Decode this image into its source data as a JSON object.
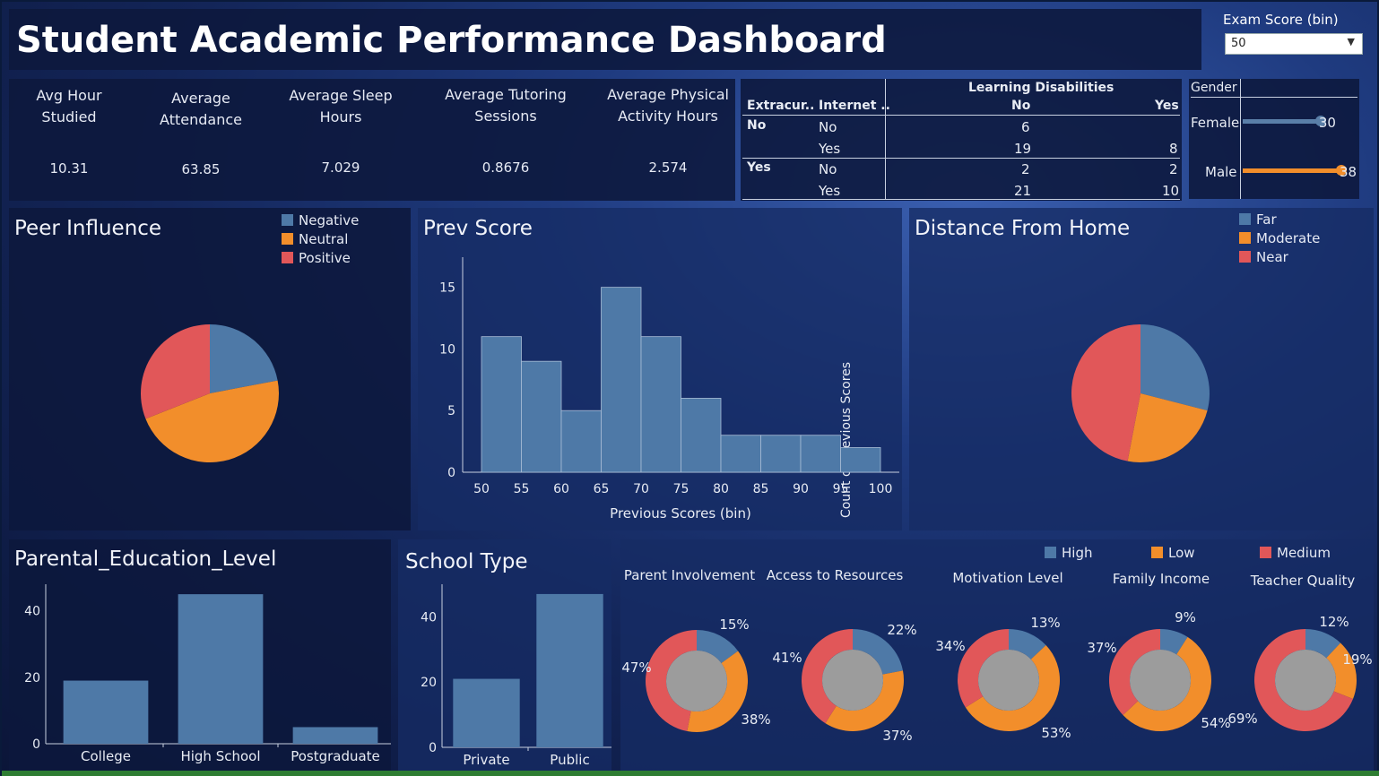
{
  "header": {
    "title": "Student Academic Performance Dashboard"
  },
  "filter": {
    "label": "Exam Score (bin)",
    "value": "50"
  },
  "kpis": [
    {
      "label": "Avg Hour Studied",
      "value": "10.31"
    },
    {
      "label": "Average Attendance",
      "value": "63.85"
    },
    {
      "label": "Average Sleep Hours",
      "value": "7.029"
    },
    {
      "label": "Average Tutoring Sessions",
      "value": "0.8676"
    },
    {
      "label": "Average Physical Activity Hours",
      "value": "2.574"
    }
  ],
  "crosstab": {
    "group_header": "Learning Disabilities",
    "col1": "Extracur..",
    "col2": "Internet ..",
    "sub_no": "No",
    "sub_yes": "Yes",
    "rows": [
      {
        "extra": "No",
        "internet": "No",
        "no": "6",
        "yes": ""
      },
      {
        "extra": "",
        "internet": "Yes",
        "no": "19",
        "yes": "8"
      },
      {
        "extra": "Yes",
        "internet": "No",
        "no": "2",
        "yes": "2"
      },
      {
        "extra": "",
        "internet": "Yes",
        "no": "21",
        "yes": "10"
      }
    ]
  },
  "gender": {
    "title": "Gender",
    "rows": [
      {
        "label": "Female",
        "value": 30,
        "value_text": "30"
      },
      {
        "label": "Male",
        "value": 38,
        "value_text": "38"
      }
    ],
    "max": 38
  },
  "colors": {
    "blue": "#4e79a7",
    "orange": "#f28e2b",
    "red": "#e15759",
    "gray": "#9c9c9c",
    "female_bar": "#5a7fa8",
    "male_bar": "#f28e2b"
  },
  "peer": {
    "title": "Peer Influence",
    "legend": [
      "Negative",
      "Neutral",
      "Positive"
    ]
  },
  "distance": {
    "title": "Distance From Home",
    "legend": [
      "Far",
      "Moderate",
      "Near"
    ]
  },
  "prev": {
    "title": "Prev Score"
  },
  "parental": {
    "title": "Parental_Education_Level"
  },
  "school": {
    "title": "School Type"
  },
  "donuts_legend": [
    "High",
    "Low",
    "Medium"
  ],
  "chart_data": [
    {
      "id": "peer",
      "type": "pie",
      "title": "Peer Influence",
      "legend_position": "top-right",
      "categories": [
        "Negative",
        "Neutral",
        "Positive"
      ],
      "values": [
        22,
        47,
        31
      ]
    },
    {
      "id": "prev",
      "type": "bar",
      "title": "Prev Score",
      "xlabel": "Previous Scores (bin)",
      "ylabel": "Count of Previous Scores",
      "x": [
        50,
        55,
        60,
        65,
        70,
        75,
        80,
        85,
        90,
        95
      ],
      "xticks": [
        "50",
        "55",
        "60",
        "65",
        "70",
        "75",
        "80",
        "85",
        "90",
        "95",
        "100"
      ],
      "values": [
        11,
        9,
        5,
        15,
        11,
        6,
        3,
        3,
        3,
        2
      ],
      "yticks": [
        0,
        5,
        10,
        15
      ],
      "ylim": [
        0,
        16.5
      ],
      "grid": false
    },
    {
      "id": "distance",
      "type": "pie",
      "title": "Distance From Home",
      "legend_position": "top-right",
      "categories": [
        "Far",
        "Moderate",
        "Near"
      ],
      "values": [
        29,
        24,
        47
      ]
    },
    {
      "id": "parental",
      "type": "bar",
      "title": "Parental_Education_Level",
      "categories": [
        "College",
        "High School",
        "Postgraduate"
      ],
      "values": [
        19,
        45,
        5
      ],
      "yticks": [
        0,
        20,
        40
      ],
      "ylim": [
        0,
        48
      ]
    },
    {
      "id": "school",
      "type": "bar",
      "title": "School Type",
      "categories": [
        "Private",
        "Public"
      ],
      "values": [
        21,
        47
      ],
      "yticks": [
        0,
        20,
        40
      ],
      "ylim": [
        0,
        50
      ]
    },
    {
      "id": "donuts",
      "type": "pie",
      "legend": [
        "High",
        "Low",
        "Medium"
      ],
      "charts": [
        {
          "title": "Parent Involvement",
          "values": [
            15,
            38,
            47
          ],
          "labels": [
            "15%",
            "38%",
            "47%"
          ]
        },
        {
          "title": "Access to Resources",
          "values": [
            22,
            37,
            41
          ],
          "labels": [
            "22%",
            "37%",
            "41%"
          ]
        },
        {
          "title": "Motivation Level",
          "values": [
            13,
            53,
            34
          ],
          "labels": [
            "13%",
            "53%",
            "34%"
          ]
        },
        {
          "title": "Family Income",
          "values": [
            9,
            54,
            37
          ],
          "labels": [
            "9%",
            "54%",
            "37%"
          ]
        },
        {
          "title": "Teacher Quality",
          "values": [
            12,
            19,
            69
          ],
          "labels": [
            "12%",
            "19%",
            "69%"
          ]
        }
      ]
    }
  ]
}
